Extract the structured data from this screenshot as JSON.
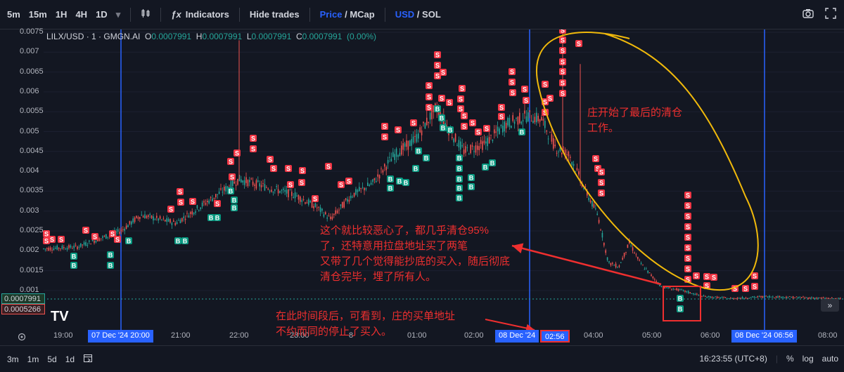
{
  "toolbar": {
    "intervals": [
      "5m",
      "15m",
      "1H",
      "4H",
      "1D"
    ],
    "indicators_label": "Indicators",
    "hide_trades_label": "Hide trades",
    "price_label": "Price",
    "mcap_label": "MCap",
    "usd_label": "USD",
    "sol_label": "SOL",
    "slash": "/"
  },
  "legend": {
    "symbol": "LILX/USD · 1 · GMGN.AI",
    "o_label": "O",
    "o": "0.0007991",
    "h_label": "H",
    "h": "0.0007991",
    "l_label": "L",
    "l": "0.0007991",
    "c_label": "C",
    "c": "0.0007991",
    "change": "(0.00%)"
  },
  "y_axis": [
    "0.0075",
    "0.007",
    "0.0065",
    "0.006",
    "0.0055",
    "0.005",
    "0.0045",
    "0.004",
    "0.0035",
    "0.003",
    "0.0025",
    "0.002",
    "0.0015",
    "0.001"
  ],
  "price_tags": {
    "current": "0.0007991",
    "low": "0.0005266"
  },
  "x_axis": {
    "ticks": [
      "19:00",
      "21:00",
      "22:00",
      "23:00",
      "8",
      "01:00",
      "02:00",
      "04:00",
      "05:00",
      "06:00",
      "08:00"
    ],
    "highlight1": "07 Dec '24  20:00",
    "highlight2_date": "08 Dec '24",
    "highlight2_time": "02:56",
    "highlight3": "08 Dec '24  06:56"
  },
  "annotations": {
    "top_right_line1": "庄开始了最后的清仓",
    "top_right_line2": "工作。",
    "middle_line1": "这个就比较恶心了，都几乎清仓95%",
    "middle_line2": "了，还特意用拉盘地址买了两笔",
    "middle_line3": "又带了几个觉得能抄底的买入，随后彻底",
    "middle_line4": "清仓完毕，埋了所有人。",
    "bottom_line1": "在此时间段后，可看到，庄的买单地址",
    "bottom_line2": "不约而同的停止了买入。"
  },
  "bottom_bar": {
    "ranges": [
      "3m",
      "1m",
      "5d",
      "1d"
    ],
    "clock": "16:23:55 (UTC+8)",
    "percent": "%",
    "log": "log",
    "auto": "auto"
  },
  "marker_labels": {
    "sell": "S",
    "buy": "B"
  },
  "colors": {
    "up": "#26a69a",
    "down": "#ef5350",
    "sell_marker": "#f23645",
    "buy_marker": "#089981",
    "accent": "#2962ff",
    "annotation": "#ef2f2f",
    "ellipse": "#f0b90b"
  },
  "logo_text": "TV"
}
